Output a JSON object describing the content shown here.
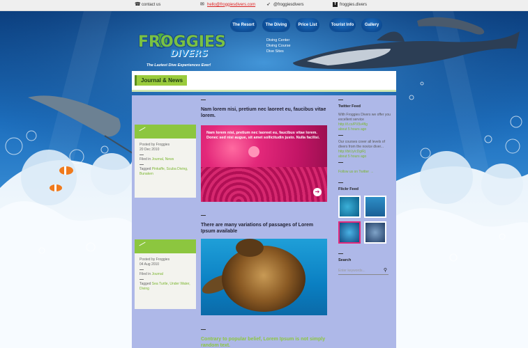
{
  "topbar": {
    "contact": "contact us",
    "email": "hello@froggiesdivers.com",
    "twitter": "@froggiesdivers",
    "facebook": "froggies.divers"
  },
  "logo": {
    "line1": "FROGGIES",
    "line2": "DIVERS",
    "tagline": "The Laziest Dive Experiences Ever!"
  },
  "nav": {
    "items": [
      "The Resort",
      "The Diving",
      "Price List",
      "Tourist Info",
      "Gallery"
    ],
    "submenu": [
      "Diving Center",
      "Diving Course",
      "Dive Sites"
    ]
  },
  "page": {
    "title": "Journal & News"
  },
  "posts": [
    {
      "title": "Nam lorem nisi, pretium nec laoreet eu, faucibus vitae lorem.",
      "overlay": "Nam lorem nisi, pretium nec laoreet eu, faucibus vitae lorem. Donec sed nisi augue, sit amet sollicitudin justo. Nulla facilisi.",
      "posted_by": "Posted by Froggies",
      "date": "20 Dec 2010",
      "filed_prefix": "Filed in",
      "filed_links": "Journal, News",
      "tagged_prefix": "Tagged",
      "tagged_links": "Pinkaffe, Scuba Diving, Bunaken"
    },
    {
      "title": "There are many variations of passages of Lorem Ipsum available",
      "posted_by": "Posted by Froggies",
      "date": "04 Aug 2010",
      "filed_prefix": "Filed in",
      "filed_links": "Journal",
      "tagged_prefix": "Tagged",
      "tagged_links": "Sea Turtle, Under Water, Diving"
    },
    {
      "title": "Contrary to popular belief, Lorem Ipsum is not simply random text."
    }
  ],
  "sidebar": {
    "twitter_heading": "Twitter Feed",
    "tweets": [
      {
        "text": "With Froggies Divers we offer you excellent service",
        "link": "http://t.co/PX5v4flg",
        "time": "about 5 hours ago"
      },
      {
        "text": "Our courses cover all levels of divers from the novice diver...",
        "link": "http://bit.ly/cDgiRj",
        "time": "about 5 hours ago"
      }
    ],
    "follow": "Follow us on Twitter →",
    "flickr_heading": "Flickr Feed",
    "search_heading": "Search",
    "search_placeholder": "Enter keywords..."
  },
  "colors": {
    "accent_green": "#8cc63f",
    "accent_pink": "#e3287a",
    "panel_bg": "#aeb8e8",
    "link_red": "#d22222"
  }
}
